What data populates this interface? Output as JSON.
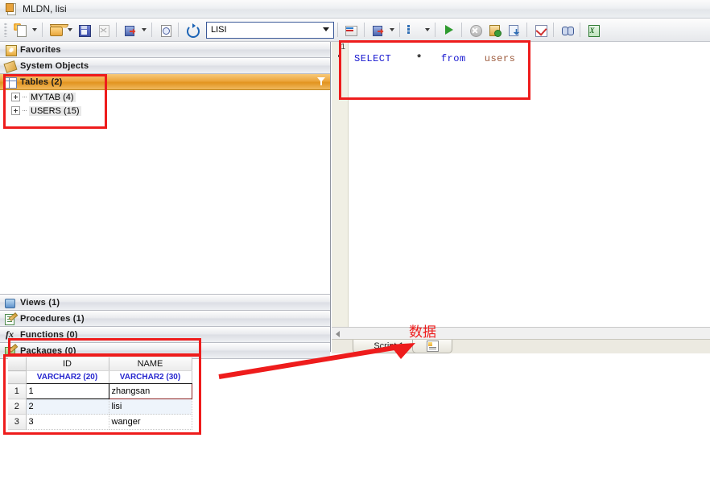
{
  "window": {
    "title": "MLDN, lisi",
    "title_icon": "document-icon"
  },
  "toolbar": {
    "buttons": [
      {
        "name": "new-file",
        "icon": "new-file-icon",
        "has_dropdown": true
      },
      {
        "name": "open-file",
        "icon": "open-folder-icon",
        "has_dropdown": true
      },
      {
        "name": "save",
        "icon": "save-disk-icon",
        "has_dropdown": false
      },
      {
        "name": "close-document",
        "icon": "close-document-icon",
        "has_dropdown": false,
        "disabled": true
      },
      {
        "name": "logout",
        "icon": "logout-icon",
        "has_dropdown": true
      },
      {
        "name": "print-preview",
        "icon": "print-preview-icon",
        "has_dropdown": false
      },
      {
        "name": "refresh",
        "icon": "refresh-icon",
        "has_dropdown": false
      },
      {
        "name": "commit",
        "icon": "commit-icon",
        "has_dropdown": false,
        "disabled": true
      },
      {
        "name": "rollback",
        "icon": "rollback-icon",
        "has_dropdown": true
      },
      {
        "name": "session-list",
        "icon": "list-lines-icon",
        "has_dropdown": true
      },
      {
        "name": "execute",
        "icon": "run-green-triangle-icon",
        "has_dropdown": false
      },
      {
        "name": "stop",
        "icon": "stop-icon",
        "has_dropdown": false
      },
      {
        "name": "explain-plan",
        "icon": "explain-plan-icon",
        "has_dropdown": false
      },
      {
        "name": "export-data",
        "icon": "export-arrow-icon",
        "has_dropdown": false
      },
      {
        "name": "check-syntax",
        "icon": "check-mark-icon",
        "has_dropdown": false
      },
      {
        "name": "find",
        "icon": "binoculars-icon",
        "has_dropdown": false
      },
      {
        "name": "export-excel",
        "icon": "excel-icon",
        "has_dropdown": false
      }
    ],
    "schema_combo": {
      "value": "LISI",
      "placeholder": "LISI"
    }
  },
  "sidebar": {
    "sections": [
      {
        "label": "Favorites",
        "icon": "favorites-icon",
        "selected": false
      },
      {
        "label": "System Objects",
        "icon": "system-objects-icon",
        "selected": false
      },
      {
        "label": "Tables  (2)",
        "icon": "tables-icon",
        "selected": true,
        "filter": "filter-funnel-icon"
      }
    ],
    "tree_items": [
      {
        "label": "MYTAB  (4)",
        "expander": "plus"
      },
      {
        "label": "USERS  (15)",
        "expander": "plus"
      }
    ],
    "sections_bottom": [
      {
        "label": "Views  (1)",
        "icon": "views-icon"
      },
      {
        "label": "Procedures  (1)",
        "icon": "procedures-icon"
      },
      {
        "label": "Functions  (0)",
        "icon": "functions-icon"
      },
      {
        "label": "Packages  (0)",
        "icon": "packages-icon"
      }
    ]
  },
  "editor": {
    "line_number": "1",
    "sql": {
      "keyword1": "SELECT",
      "star": "*",
      "keyword2": "from",
      "identifier": "users"
    },
    "tabs": [
      {
        "label": "Script 1",
        "icon": null
      },
      {
        "label": "",
        "icon": "result-sheet-icon"
      }
    ]
  },
  "result_grid": {
    "columns": [
      {
        "name": "ID",
        "type": "VARCHAR2 (20)"
      },
      {
        "name": "NAME",
        "type": "VARCHAR2 (30)"
      }
    ],
    "rows": [
      {
        "num": "1",
        "ID": "1",
        "NAME": "zhangsan"
      },
      {
        "num": "2",
        "ID": "2",
        "NAME": "lisi"
      },
      {
        "num": "3",
        "ID": "3",
        "NAME": "wanger"
      }
    ]
  },
  "annotations": {
    "label_cn": "数据",
    "color": "#ee1c1c"
  }
}
